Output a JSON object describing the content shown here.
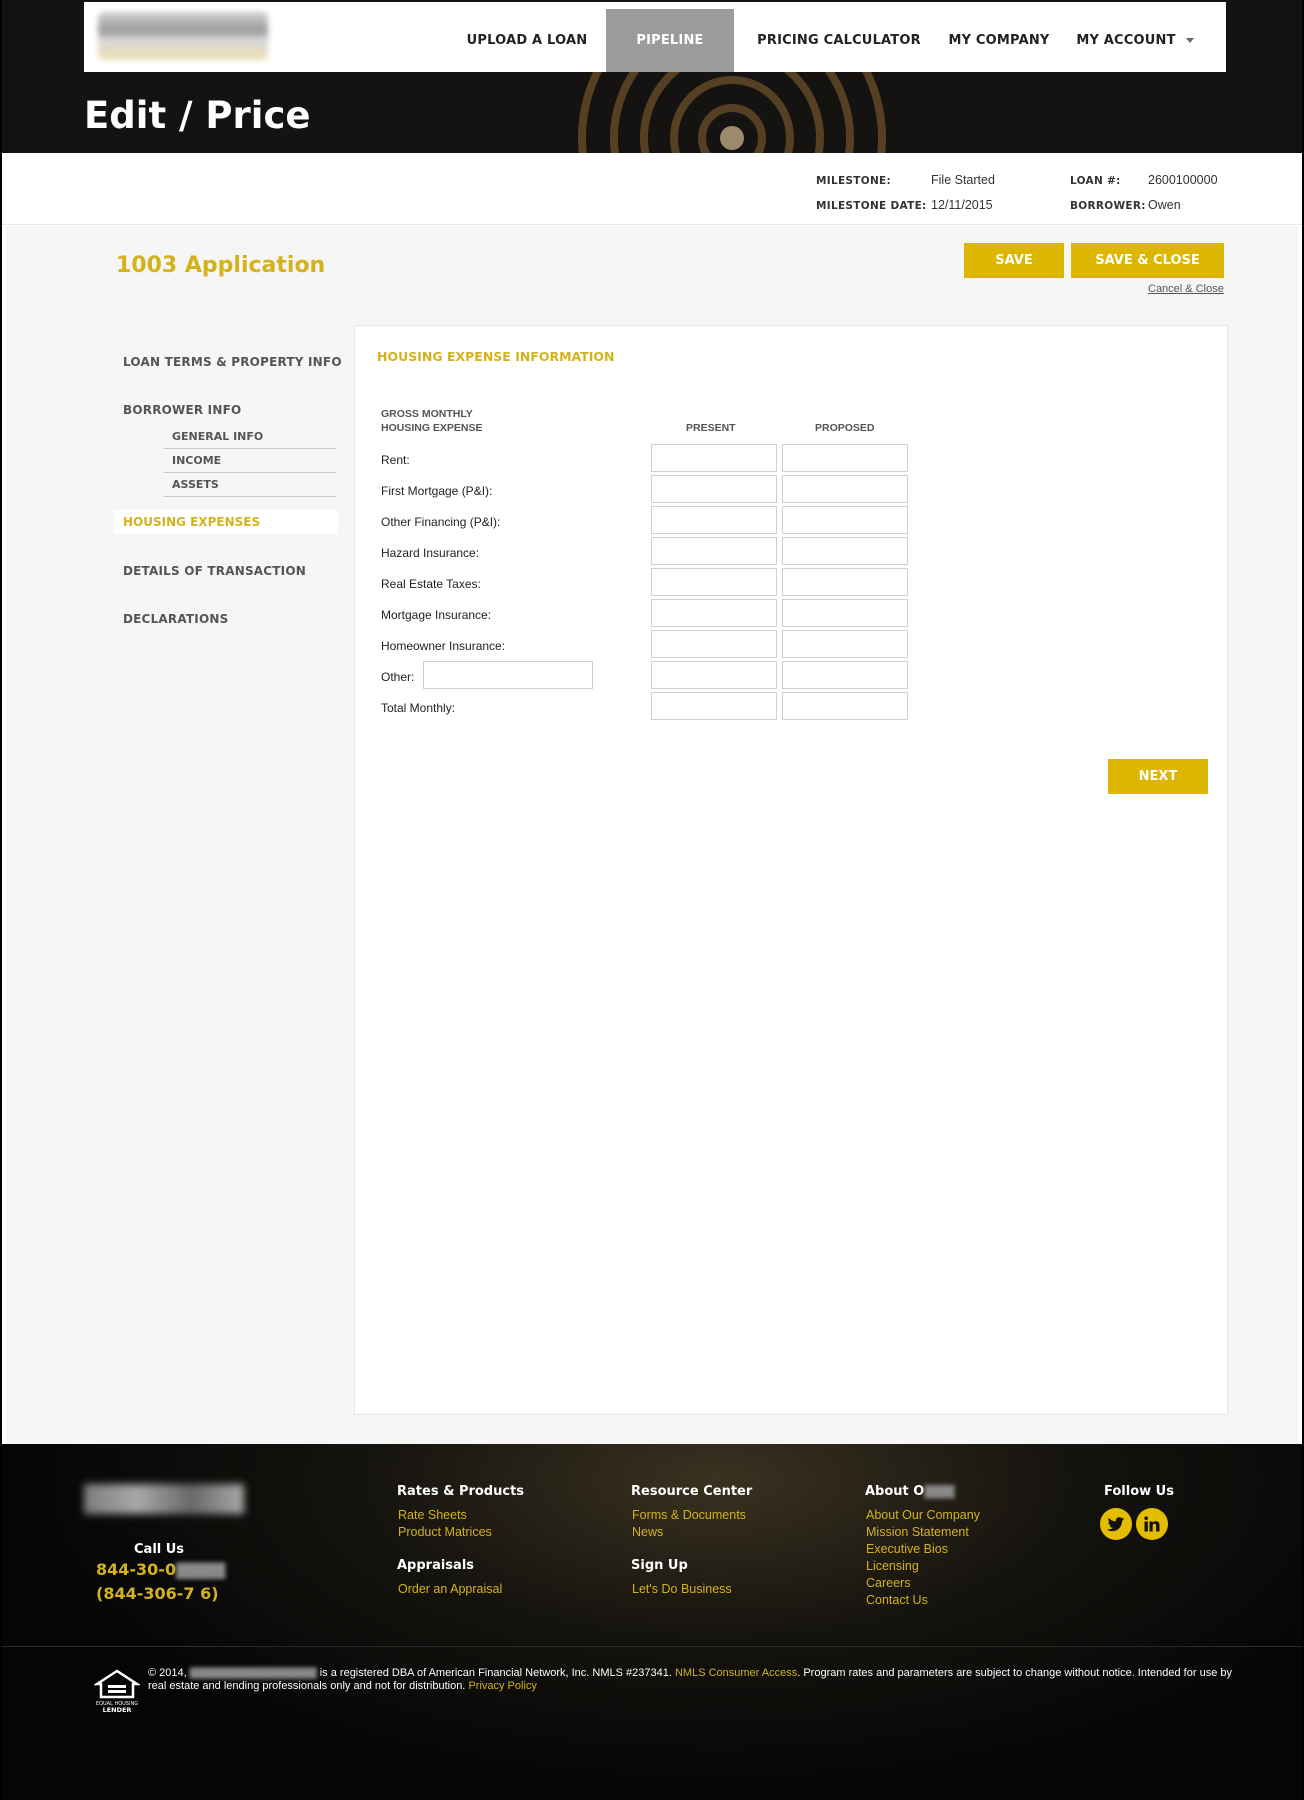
{
  "nav": {
    "items": [
      "UPLOAD A LOAN",
      "PIPELINE",
      "PRICING CALCULATOR",
      "MY COMPANY",
      "MY ACCOUNT"
    ],
    "active": "PIPELINE"
  },
  "page_title": "Edit / Price",
  "milestone": {
    "milestone_label": "MILESTONE:",
    "milestone_value": "File Started",
    "date_label": "MILESTONE DATE:",
    "date_value": "12/11/2015",
    "loan_label": "LOAN #:",
    "loan_value": "2600100000",
    "borrower_label": "BORROWER:",
    "borrower_value": "Owen"
  },
  "app": {
    "title": "1003 Application",
    "save_label": "SAVE",
    "save_close_label": "SAVE & CLOSE",
    "cancel_label": "Cancel & Close",
    "next_label": "NEXT"
  },
  "sidebar": {
    "loan_terms": "LOAN TERMS & PROPERTY INFO",
    "borrower_info": "BORROWER INFO",
    "sub_items": [
      "GENERAL INFO",
      "INCOME",
      "ASSETS"
    ],
    "housing_expenses": "HOUSING EXPENSES",
    "details": "DETAILS OF TRANSACTION",
    "declarations": "DECLARATIONS"
  },
  "form": {
    "section_title": "HOUSING EXPENSE INFORMATION",
    "gross_line1": "GROSS MONTHLY",
    "gross_line2": "HOUSING EXPENSE",
    "col_present": "PRESENT",
    "col_proposed": "PROPOSED",
    "rows": [
      {
        "label": "Rent:",
        "present": "",
        "proposed": ""
      },
      {
        "label": "First Mortgage (P&I):",
        "present": "",
        "proposed": ""
      },
      {
        "label": "Other Financing (P&I):",
        "present": "",
        "proposed": ""
      },
      {
        "label": "Hazard Insurance:",
        "present": "",
        "proposed": ""
      },
      {
        "label": "Real Estate Taxes:",
        "present": "",
        "proposed": ""
      },
      {
        "label": "Mortgage Insurance:",
        "present": "",
        "proposed": ""
      },
      {
        "label": "Homeowner Insurance:",
        "present": "",
        "proposed": ""
      },
      {
        "label": "Other:",
        "present": "",
        "proposed": ""
      },
      {
        "label": "Total Monthly:",
        "present": "",
        "proposed": ""
      }
    ],
    "other_description": ""
  },
  "footer": {
    "call_us": "Call Us",
    "phone1": "844-30-0",
    "phone2": "(844-306-7 6)",
    "rates_head": "Rates & Products",
    "rates_links": [
      "Rate Sheets",
      "Product Matrices"
    ],
    "appraisals_head": "Appraisals",
    "appraisals_links": [
      "Order an Appraisal"
    ],
    "resource_head": "Resource Center",
    "resource_links": [
      "Forms & Documents",
      "News"
    ],
    "signup_head": "Sign Up",
    "signup_links": [
      "Let's Do Business"
    ],
    "about_head": "About O",
    "about_links": [
      "About Our Company",
      "Mission Statement",
      "Executive Bios",
      "Licensing",
      "Careers",
      "Contact Us"
    ],
    "follow_head": "Follow Us",
    "legal_prefix": "© 2014,",
    "legal_mid": "is a registered DBA of American Financial Network, Inc. NMLS #237341.",
    "legal_link": "NMLS Consumer Access",
    "legal_suffix": ". Program rates and parameters are subject to change without notice. Intended for use by real estate and lending professionals only and not for distribution.",
    "privacy_link": "Privacy Policy",
    "eho_text1": "EQUAL HOUSING",
    "eho_text2": "LENDER"
  },
  "colors": {
    "accent": "#dcb600",
    "header_bg": "#141311",
    "nav_active": "#9b9b9b"
  }
}
